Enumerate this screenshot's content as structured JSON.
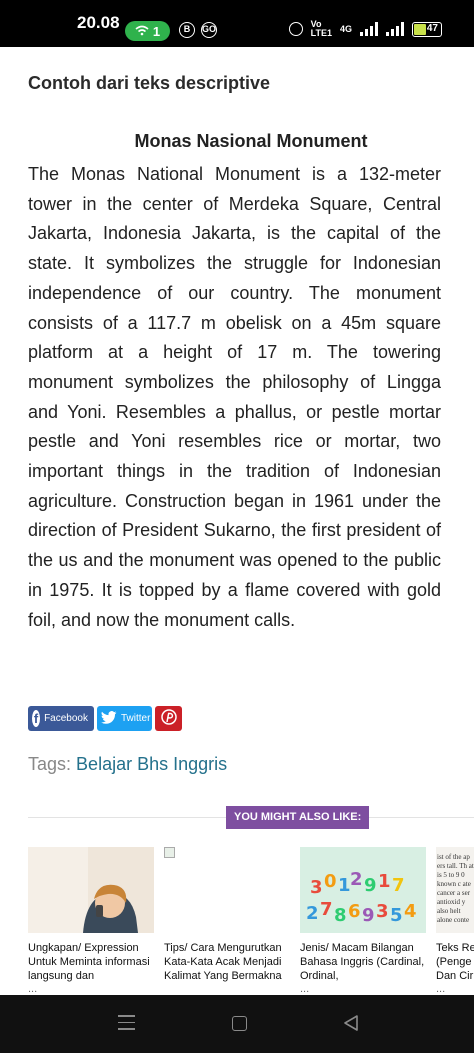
{
  "status_bar": {
    "time": "20.08",
    "hotspot_count": "1",
    "notif_b": "B",
    "notif_go": "GO",
    "volte_top": "Vo",
    "volte_bottom": "LTE1",
    "network": "4G",
    "battery": "47"
  },
  "article": {
    "section_title": "Contoh dari teks descriptive",
    "heading": "Monas Nasional Monument",
    "body": "The Monas National Monument is a 132-meter tower in the center of Merdeka Square, Central Jakarta, Indonesia Jakarta, is the capital of the state. It symbolizes the struggle for Indonesian independence of our country. The monument consists of a 117.7 m obelisk on a 45m square platform at a height of 17 m. The towering monument symbolizes the philosophy of Lingga and Yoni. Resembles a phallus, or pestle mortar pestle and Yoni resembles rice or mortar, two important things in the tradition of Indonesian agriculture. Construction began in 1961 under the direction of President Sukarno, the first president of the us and the monument was opened to the public in 1975. It is topped by a flame covered with gold foil, and now the monument calls."
  },
  "share": {
    "facebook_label": "Facebook",
    "twitter_label": "Twitter",
    "facebook_icon": "facebook-icon",
    "twitter_icon": "twitter-icon",
    "pinterest_icon": "pinterest-icon"
  },
  "tags": {
    "label": "Tags:",
    "items": [
      "Belajar Bhs Inggris"
    ]
  },
  "related": {
    "heading": "YOU MIGHT ALSO LIKE:",
    "items": [
      {
        "title": "Ungkapan/ Expression Untuk Meminta informasi langsung dan",
        "more": "..."
      },
      {
        "title": "Tips/ Cara Mengurutkan Kata-Kata Acak Menjadi Kalimat Yang Bermakna",
        "more": ""
      },
      {
        "title": "Jenis/ Macam Bilangan Bahasa Inggris (Cardinal, Ordinal,",
        "more": "..."
      },
      {
        "title": "Teks Re (Penge Dan Cir",
        "more": "..."
      }
    ],
    "thumb4_text": "ist of the ap ers tall. Th at is 5 to 9 0 known c ate cancer a ser antioxid y also helt alone conte"
  },
  "colors": {
    "accent_purple": "#7e4ea0",
    "facebook": "#3b5998",
    "twitter": "#1da1f2",
    "pinterest": "#cb2027",
    "tag_link": "#24718c",
    "hotspot_green": "#2fb24c"
  }
}
